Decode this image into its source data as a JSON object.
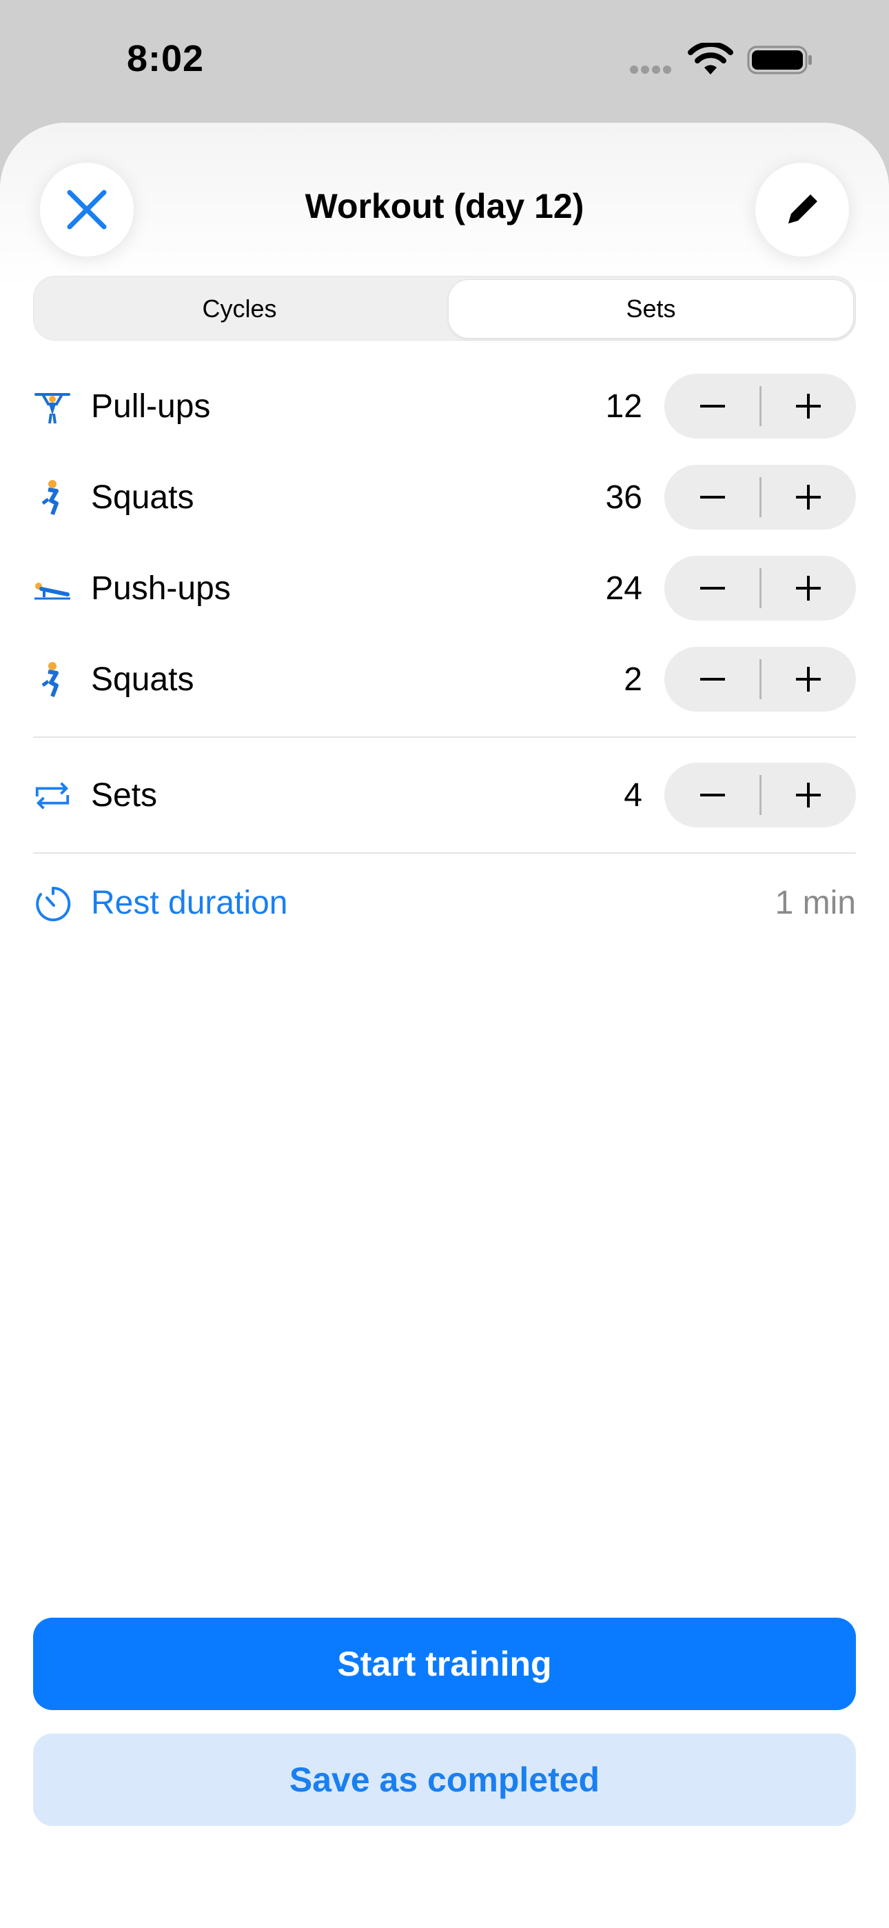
{
  "status_bar": {
    "time": "8:02"
  },
  "header": {
    "title": "Workout (day 12)",
    "close_icon": "close-icon",
    "edit_icon": "pencil-icon"
  },
  "tabs": [
    {
      "label": "Cycles",
      "active": false
    },
    {
      "label": "Sets",
      "active": true
    }
  ],
  "exercises": [
    {
      "name": "Pull-ups",
      "count": "12",
      "icon": "pullup-icon"
    },
    {
      "name": "Squats",
      "count": "36",
      "icon": "squat-icon"
    },
    {
      "name": "Push-ups",
      "count": "24",
      "icon": "pushup-icon"
    },
    {
      "name": "Squats",
      "count": "2",
      "icon": "squat-icon"
    }
  ],
  "sets": {
    "label": "Sets",
    "count": "4",
    "icon": "repeat-icon"
  },
  "rest": {
    "label": "Rest duration",
    "value": "1 min",
    "icon": "timer-icon"
  },
  "actions": {
    "start_label": "Start training",
    "save_label": "Save as completed"
  },
  "colors": {
    "accent": "#0a7bff",
    "accent_light": "#d9e9fb",
    "figure": "#f4a93b",
    "figure_blue": "#1a6fd6"
  }
}
